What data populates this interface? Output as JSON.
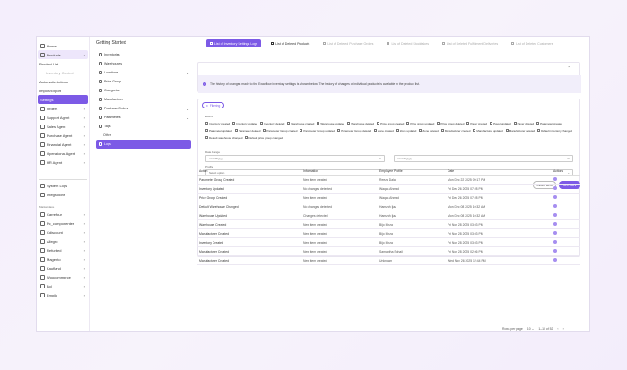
{
  "sidebar": {
    "items": [
      {
        "label": "Home"
      },
      {
        "label": "Products",
        "chev": "›"
      },
      {
        "label": "Automatic Actions"
      },
      {
        "label": "Import/Export"
      },
      {
        "label": "Settings"
      },
      {
        "label": "Orders",
        "chev": "›"
      },
      {
        "label": "Support Agent",
        "chev": "›"
      },
      {
        "label": "Sales Agent",
        "chev": "›"
      },
      {
        "label": "Purchase Agent",
        "chev": "›"
      },
      {
        "label": "Financial Agent",
        "chev": "›"
      },
      {
        "label": "Operational Agent",
        "chev": "›"
      },
      {
        "label": "HR Agent",
        "chev": "›"
      },
      {
        "label": "System Logs"
      },
      {
        "label": "Integrations"
      }
    ],
    "sub_product_list": "Product List",
    "sub_inventory_control": "Inventory Control",
    "marketplace_label": "Marketplace",
    "marketplaces": [
      {
        "label": "Carrefour"
      },
      {
        "label": "Pc_componentes"
      },
      {
        "label": "Cdiscount"
      },
      {
        "label": "Allegro"
      },
      {
        "label": "Refurbed"
      },
      {
        "label": "Magento"
      },
      {
        "label": "Kaufland"
      },
      {
        "label": "Woocommerce"
      },
      {
        "label": "Bol"
      },
      {
        "label": "Empik"
      }
    ]
  },
  "col2": {
    "title": "Getting Started",
    "items": [
      {
        "label": "Inventories"
      },
      {
        "label": "Warehouses"
      },
      {
        "label": "Locations",
        "chev": "⌄"
      },
      {
        "label": "Price Group"
      },
      {
        "label": "Categories"
      },
      {
        "label": "Manufacturer"
      },
      {
        "label": "Purchase Orders",
        "chev": "⌄"
      },
      {
        "label": "Parameters",
        "chev": "⌄"
      },
      {
        "label": "Tags"
      },
      {
        "label": "Other"
      },
      {
        "label": "Logs"
      }
    ]
  },
  "tabs": [
    {
      "label": "List of Inventory Settings Logs"
    },
    {
      "label": "List of Deleted Products"
    },
    {
      "label": "List of Deleted Purchase Orders"
    },
    {
      "label": "List of Deleted Stocktakes"
    },
    {
      "label": "List of Deleted Fulfillment Deliveries"
    },
    {
      "label": "List of Deleted Customers"
    }
  ],
  "info_text": "The history of changes made to the Exactflow inventory settings is shown below. The history of changes of individual products is available in the product list.",
  "filter_button": "Filtering",
  "filters": {
    "events_label": "Events",
    "events": [
      "Inventory created",
      "Inventory updated",
      "Inventory deleted",
      "Warehouse created",
      "Warehouse updated",
      "Warehouse deleted",
      "Price group created",
      "Price group updated",
      "Price group deleted",
      "Payer created",
      "Payer updated",
      "Payer deleted",
      "Parameter created",
      "Parameter updated",
      "Parameter deleted",
      "Parameter Group created",
      "Parameter Group updated",
      "Parameter Group deleted",
      "Zone created",
      "Zone updated",
      "Zone deleted",
      "Manufacturer created",
      "Manufacturer updated",
      "Manufacturer deleted",
      "Default inventory changed",
      "Default warehouse changed",
      "Default price group changed"
    ],
    "date_range_label": "Date Range",
    "date_from_placeholder": "mm/dd/yyyy",
    "date_to_placeholder": "mm/dd/yyyy",
    "profile_label": "Profile",
    "profile_placeholder": "Select option",
    "clear_label": "Clear Filters",
    "set_label": "Set Filters"
  },
  "table": {
    "headers": [
      "Action",
      "Information",
      "Employee Profile",
      "Date",
      "Actions"
    ],
    "rows": [
      [
        "Parameter Group Created",
        "New item created",
        "Reeza Dalal",
        "Mon Dec 22 2025 09:17 PM"
      ],
      [
        "Inventory Updated",
        "No changes detected",
        "Waqas Ahmad",
        "Fri Dec 26 2025 07:28 PM"
      ],
      [
        "Price Group Created",
        "New item created",
        "Waqas Ahmad",
        "Fri Dec 26 2025 07:28 PM"
      ],
      [
        "Default Warehouse Changed",
        "No changes detected",
        "Hamzah Ijaz",
        "Mon Dec 08 2025 10:32 AM"
      ],
      [
        "Warehouse Updated",
        "Changes detected",
        "Hamzah Ijaz",
        "Mon Dec 08 2025 10:32 AM"
      ],
      [
        "Warehouse Created",
        "New item created",
        "Bijo Mirza",
        "Fri Nov 28 2025 03:03 PM"
      ],
      [
        "Manufacturer Created",
        "New item created",
        "Bijo Mirza",
        "Fri Nov 28 2025 03:03 PM"
      ],
      [
        "Inventory Created",
        "New item created",
        "Bijo Mirza",
        "Fri Nov 28 2025 03:03 PM"
      ],
      [
        "Manufacturer Created",
        "New item created",
        "Samantha Sohail",
        "Fri Nov 28 2025 02:06 PM"
      ],
      [
        "Manufacturer Created",
        "New item created",
        "Unknown",
        "Wed Nov 26 2025 12:44 PM"
      ]
    ]
  },
  "pager": {
    "rows_label": "Rows per page",
    "rows_value": "10",
    "range": "1–10 of 52",
    "prev": "‹",
    "next": "›"
  },
  "colors": {
    "accent": "#7c5ae6",
    "info_bg": "#f1eefa"
  }
}
